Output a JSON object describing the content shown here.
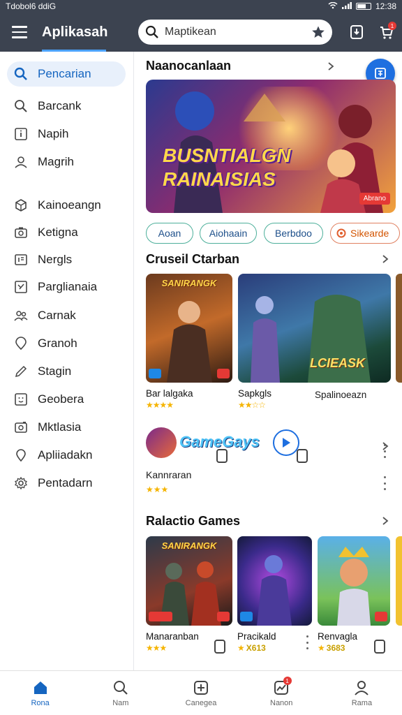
{
  "status": {
    "left_text": "Tdobol6 ddiG",
    "time": "12:38"
  },
  "appbar": {
    "title": "Aplikasah",
    "search_placeholder": "Maptikean",
    "cart_badge": "1"
  },
  "sidebar": {
    "items": [
      {
        "label": "Pencarian",
        "icon": "search-icon",
        "active": true
      },
      {
        "label": "Barcank",
        "icon": "search-icon"
      },
      {
        "label": "Napih",
        "icon": "info-icon"
      },
      {
        "label": "Magrih",
        "icon": "person-icon"
      },
      {
        "label": "Kainoeangn",
        "icon": "cube-icon"
      },
      {
        "label": "Ketigna",
        "icon": "camera-icon"
      },
      {
        "label": "Nergls",
        "icon": "id-card-icon"
      },
      {
        "label": "Parglianaia",
        "icon": "image-icon"
      },
      {
        "label": "Carnak",
        "icon": "people-icon"
      },
      {
        "label": "Granoh",
        "icon": "location-icon"
      },
      {
        "label": "Stagin",
        "icon": "pencil-icon"
      },
      {
        "label": "Geobera",
        "icon": "face-icon"
      },
      {
        "label": "Mktlasia",
        "icon": "photo-icon"
      },
      {
        "label": "Apliiadakn",
        "icon": "pin-icon"
      },
      {
        "label": "Pentadarn",
        "icon": "gear-icon"
      }
    ]
  },
  "featured": {
    "title": "Naanocanlaan",
    "banner_text": "BUSNTIALGN RAINAISIAS",
    "banner_badge": "Abrano"
  },
  "chips": [
    "Aoan",
    "Aiohaain",
    "Berbdoo",
    "Sikearde"
  ],
  "section2": {
    "title": "Cruseil Ctarban",
    "cards": [
      {
        "name": "Bar lalgaka",
        "stars": "★★★★",
        "thumb_label": "SANIRANGK"
      },
      {
        "name": "Sapkgls",
        "stars": "★★☆☆",
        "thumb_label": ""
      },
      {
        "name": "Spalinoeazn",
        "stars": "",
        "thumb_label": "LCIEASK"
      }
    ],
    "promo": {
      "brand": "GameGays",
      "name": "Kannraran",
      "stars": "★★★"
    }
  },
  "section3": {
    "title": "Ralactio Games",
    "cards": [
      {
        "name": "Manaranban",
        "stars": "★★★",
        "rating": "",
        "thumb_label": "SANIRANGK"
      },
      {
        "name": "Pracikald",
        "stars": "★",
        "rating": "X613",
        "thumb_label": ""
      },
      {
        "name": "Renvagla",
        "stars": "★",
        "rating": "3683",
        "thumb_label": ""
      }
    ]
  },
  "bottomnav": {
    "items": [
      {
        "label": "Rona",
        "icon": "home-icon",
        "active": true
      },
      {
        "label": "Nam",
        "icon": "search-icon"
      },
      {
        "label": "Canegea",
        "icon": "add-icon"
      },
      {
        "label": "Nanon",
        "icon": "activity-icon",
        "badge": "1"
      },
      {
        "label": "Rama",
        "icon": "person-icon"
      }
    ]
  },
  "colors": {
    "appbar": "#3c4350",
    "accent": "#1e6fe0",
    "active_bg": "#e8f0fb",
    "star": "#f5b400"
  }
}
